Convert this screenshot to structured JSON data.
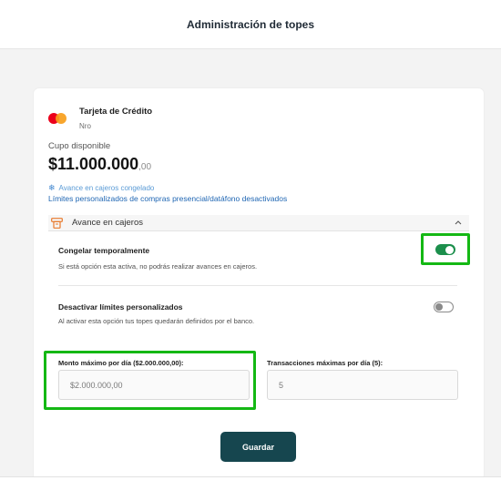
{
  "header": {
    "title": "Administración de topes"
  },
  "card": {
    "name": "Tarjeta de Crédito",
    "number_label": "Nro",
    "logo_icon": "mastercard-logo"
  },
  "balance": {
    "label": "Cupo disponible",
    "amount": "$11.000.000",
    "cents": ",00"
  },
  "status": {
    "frozen_icon": "snowflake-icon",
    "frozen_text": "Avance en cajeros congelado",
    "limits_text": "Límites personalizados de compras presencial/datáfono desactivados"
  },
  "section": {
    "icon": "atm-icon",
    "title": "Avance en cajeros",
    "expanded": true
  },
  "options": {
    "freeze": {
      "title": "Congelar temporalmente",
      "description": "Si está opción esta activa, no podrás realizar avances en cajeros.",
      "enabled": true
    },
    "custom_limits": {
      "title": "Desactivar límites personalizados",
      "description": "Al activar esta opción tus topes quedarán definidos por el banco.",
      "enabled": false
    }
  },
  "fields": {
    "max_amount": {
      "label": "Monto máximo por día ($2.000.000,00):",
      "value": "$2.000.000,00"
    },
    "max_transactions": {
      "label": "Transacciones máximas por día (5):",
      "value": "5"
    }
  },
  "actions": {
    "save_label": "Guardar"
  },
  "colors": {
    "accent": "#16464f",
    "toggle_on": "#1c8f4c",
    "highlight": "#14b814",
    "link": "#1f66b3"
  }
}
